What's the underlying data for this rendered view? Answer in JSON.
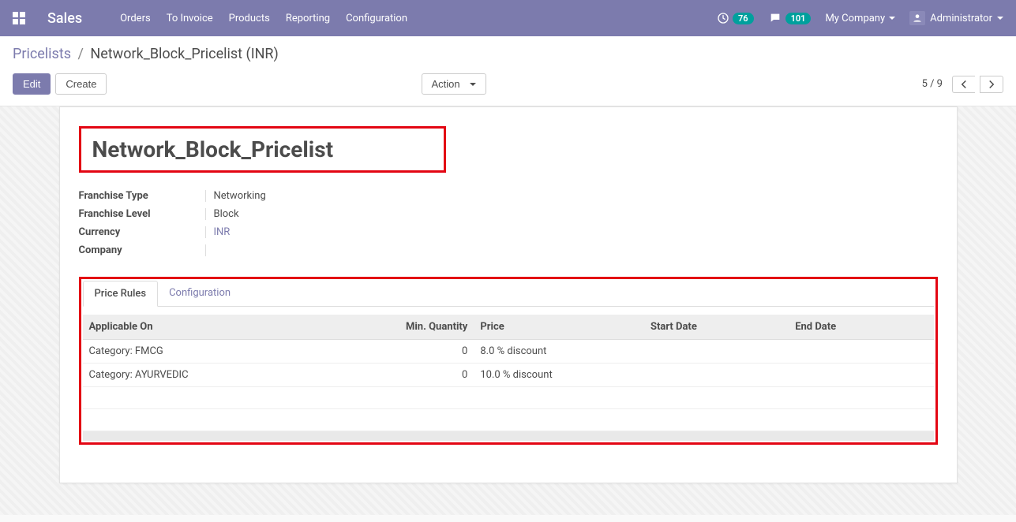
{
  "navbar": {
    "brand": "Sales",
    "links": [
      "Orders",
      "To Invoice",
      "Products",
      "Reporting",
      "Configuration"
    ],
    "activity_badge": "76",
    "message_badge": "101",
    "company": "My Company",
    "user": "Administrator"
  },
  "breadcrumb": {
    "parent": "Pricelists",
    "current": "Network_Block_Pricelist (INR)"
  },
  "buttons": {
    "edit": "Edit",
    "create": "Create",
    "action": "Action"
  },
  "pager": {
    "text": "5 / 9"
  },
  "record": {
    "title": "Network_Block_Pricelist",
    "fields": {
      "franchise_type_label": "Franchise Type",
      "franchise_type_value": "Networking",
      "franchise_level_label": "Franchise Level",
      "franchise_level_value": "Block",
      "currency_label": "Currency",
      "currency_value": "INR",
      "company_label": "Company",
      "company_value": ""
    }
  },
  "tabs": {
    "price_rules": "Price Rules",
    "configuration": "Configuration"
  },
  "table": {
    "headers": {
      "applicable_on": "Applicable On",
      "min_qty": "Min. Quantity",
      "price": "Price",
      "start_date": "Start Date",
      "end_date": "End Date"
    },
    "rows": [
      {
        "applicable_on": "Category: FMCG",
        "min_qty": "0",
        "price": "8.0 % discount",
        "start_date": "",
        "end_date": ""
      },
      {
        "applicable_on": "Category: AYURVEDIC",
        "min_qty": "0",
        "price": "10.0 % discount",
        "start_date": "",
        "end_date": ""
      }
    ]
  }
}
